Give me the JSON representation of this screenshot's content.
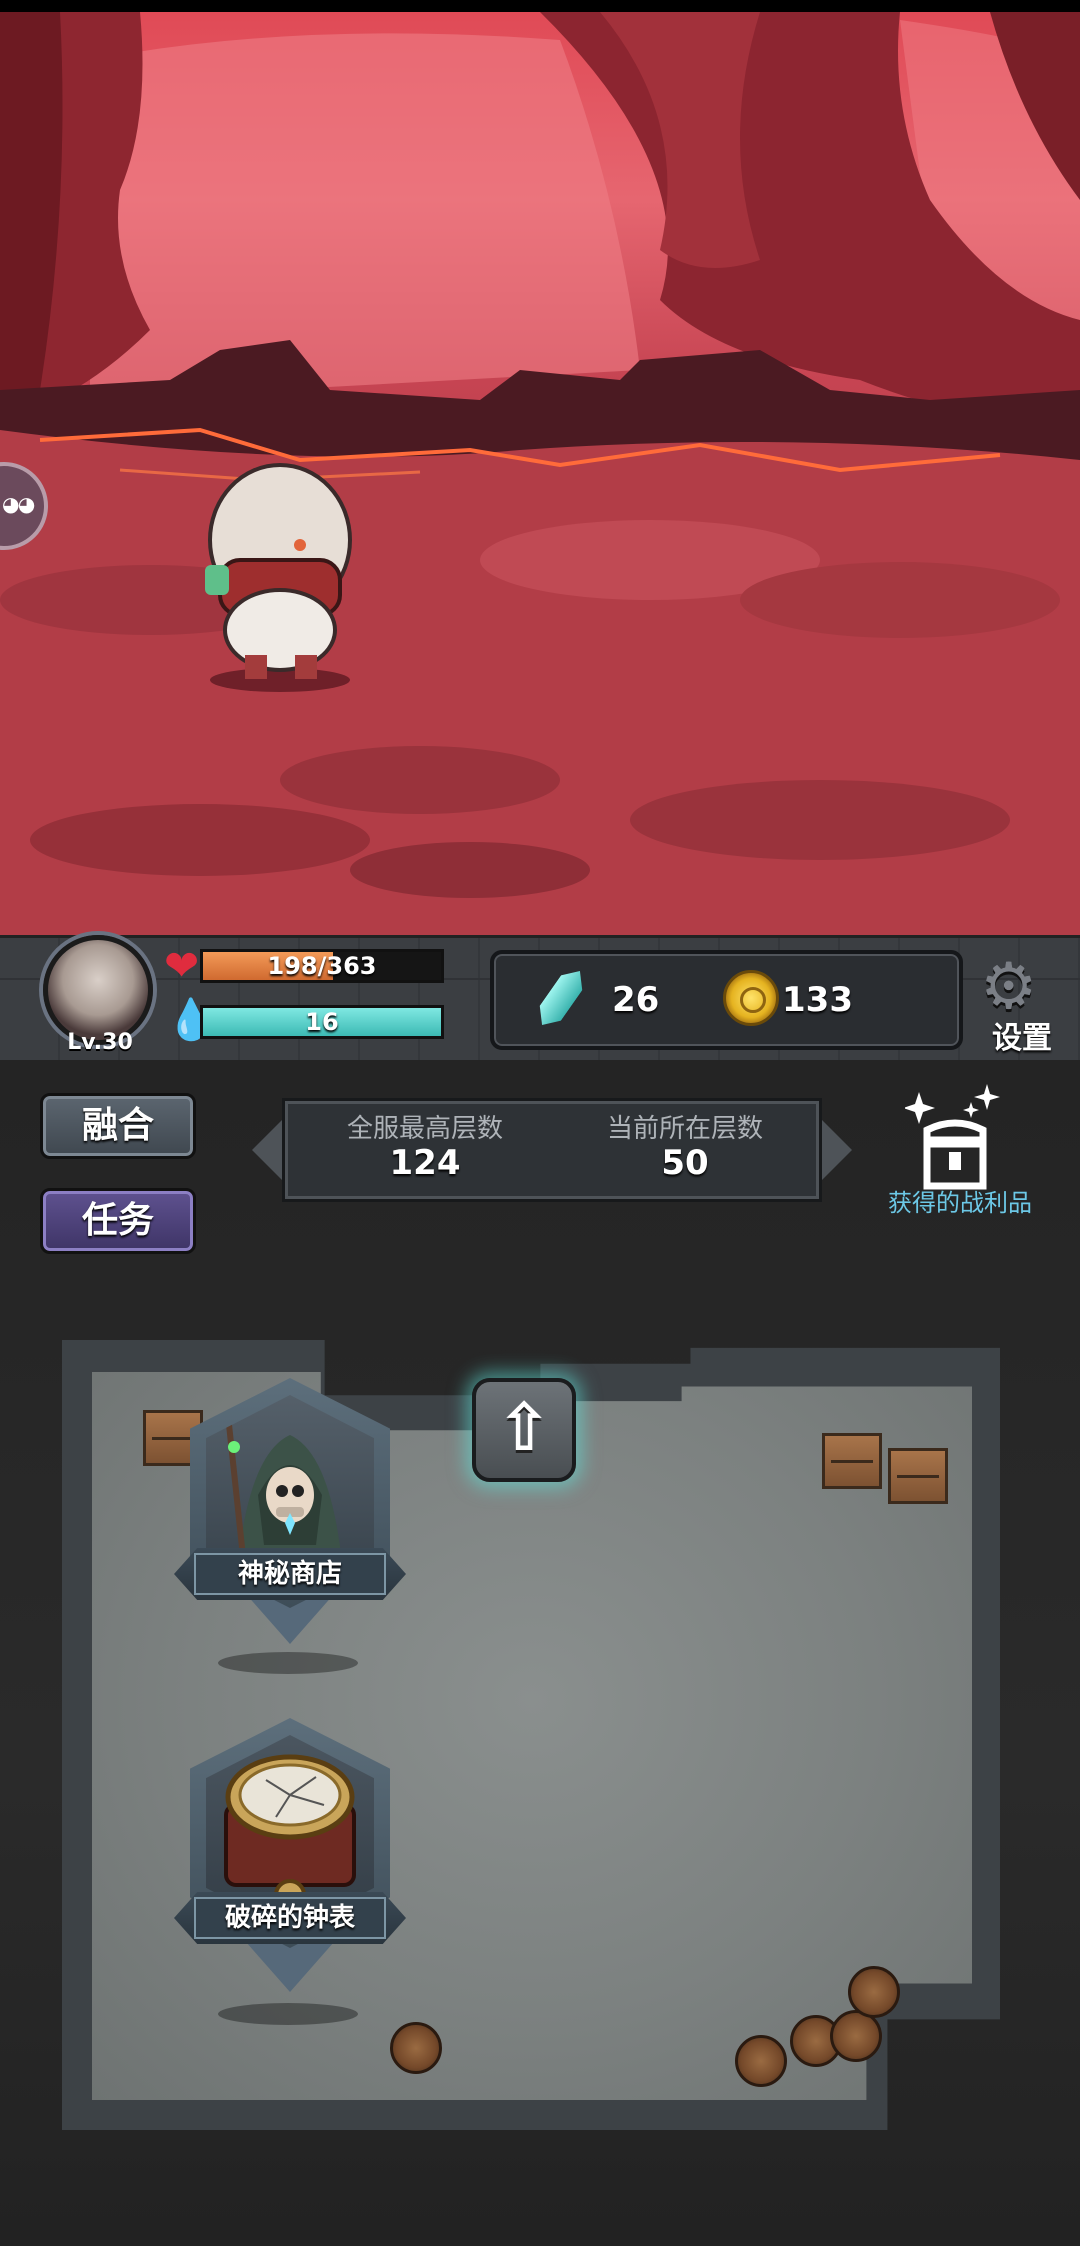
{
  "player": {
    "level": "Lv.30",
    "hp_text": "198/363",
    "hp_current": 198,
    "hp_max": 363,
    "mp_text": "16",
    "colors": {
      "hp": "#e8853f",
      "mp": "#5ad6cf"
    }
  },
  "currency": {
    "crystal": "26",
    "coin": "133"
  },
  "settings_label": "设置",
  "buttons": {
    "merge": "融合",
    "task": "任务"
  },
  "floors": {
    "server_best_label": "全服最高层数",
    "server_best_value": "124",
    "current_label": "当前所在层数",
    "current_value": "50"
  },
  "loot_label": "获得的战利品",
  "room": {
    "shop_label": "神秘商店",
    "clock_label": "破碎的钟表"
  },
  "icons": [
    "heart-icon",
    "flame-icon",
    "crystal-icon",
    "coin-icon",
    "gear-icon",
    "loot-chest-icon",
    "up-arrow-icon"
  ]
}
